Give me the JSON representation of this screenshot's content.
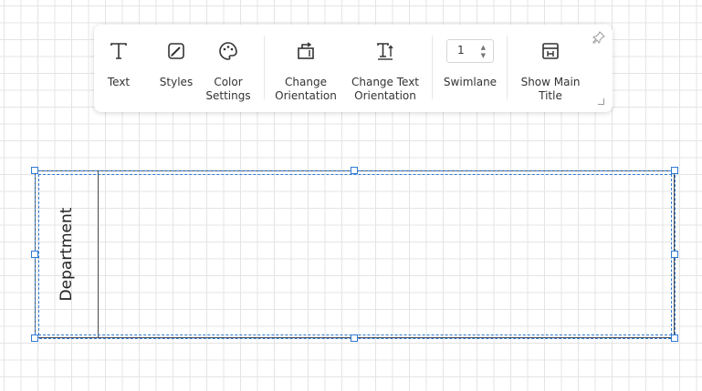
{
  "toolbar": {
    "text_label": "Text",
    "styles_label": "Styles",
    "color_settings_label": "Color\nSettings",
    "change_orientation_label": "Change\nOrientation",
    "change_text_orientation_label": "Change Text\nOrientation",
    "swimlane_value": "1",
    "swimlane_label": "Swimlane",
    "show_main_title_label": "Show Main\nTitle",
    "pin_icon": "pin-icon"
  },
  "canvas": {
    "lane_title": "Department"
  },
  "colors": {
    "selection": "#2f7ad4",
    "lane_border": "#4a4a4a",
    "grid": "#e4e4e4"
  }
}
